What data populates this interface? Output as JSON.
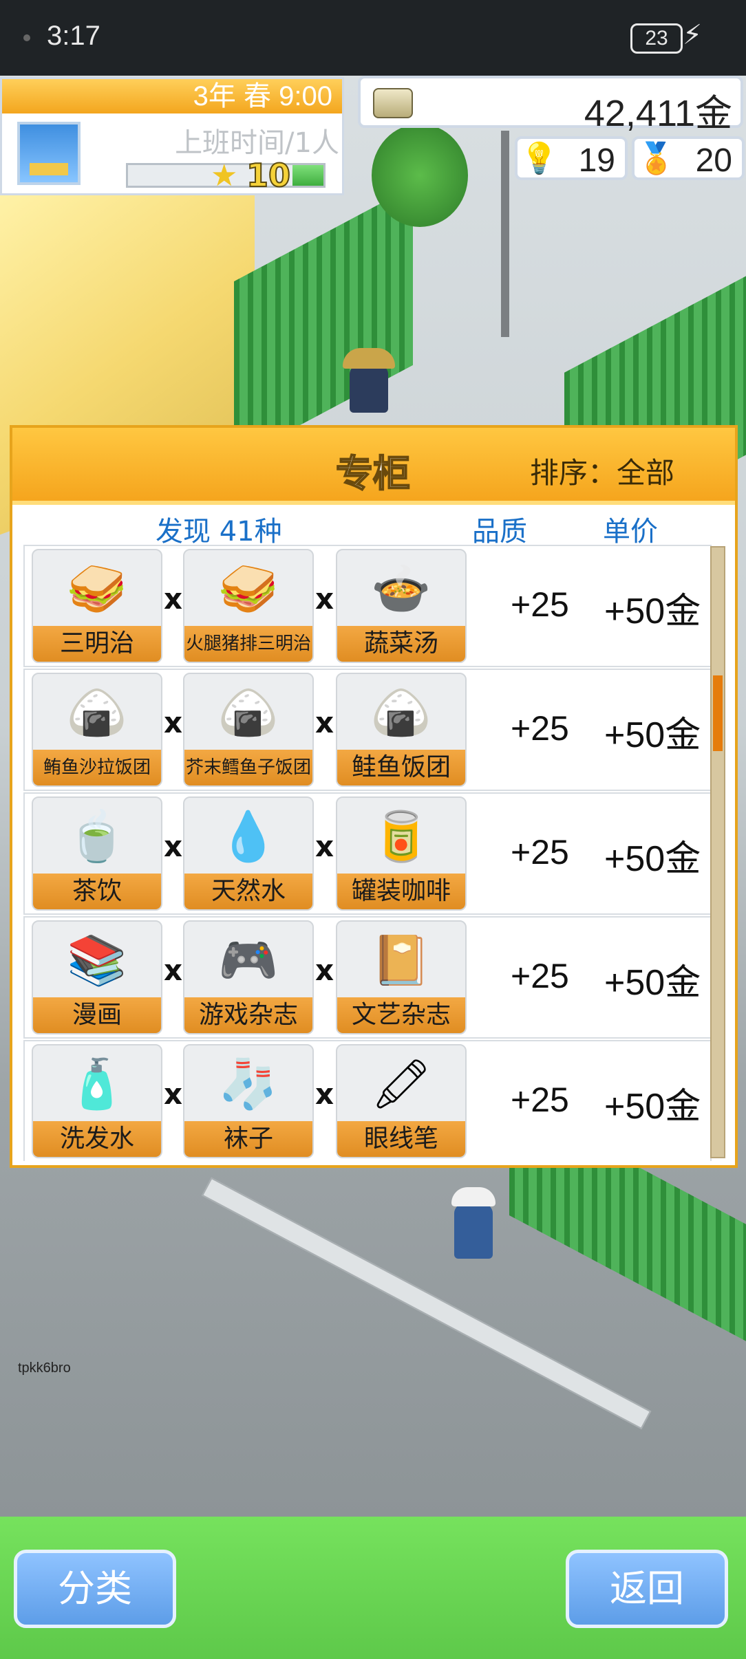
{
  "status_bar": {
    "time": "3:17",
    "battery": "23"
  },
  "hud": {
    "date": "3年 春 9:00",
    "staff_status": "上班时间/1人",
    "level": "10",
    "money": "42,411金",
    "research_points": "19",
    "medals": "20"
  },
  "panel": {
    "title": "专柜",
    "sort_label": "排序：全部",
    "found_label": "发现 41种",
    "quality_header": "品质",
    "price_header": "单价",
    "rows": [
      {
        "items": [
          "三明治",
          "火腿猪排三明治",
          "蔬菜汤"
        ],
        "quality": "+25",
        "price": "+50金"
      },
      {
        "items": [
          "鲔鱼沙拉饭团",
          "芥末鳕鱼子饭团",
          "鲑鱼饭团"
        ],
        "quality": "+25",
        "price": "+50金"
      },
      {
        "items": [
          "茶饮",
          "天然水",
          "罐装咖啡"
        ],
        "quality": "+25",
        "price": "+50金"
      },
      {
        "items": [
          "漫画",
          "游戏杂志",
          "文艺杂志"
        ],
        "quality": "+25",
        "price": "+50金"
      },
      {
        "items": [
          "洗发水",
          "袜子",
          "眼线笔"
        ],
        "quality": "+25",
        "price": "+50金"
      }
    ],
    "scroll_position": 0.24
  },
  "bottom": {
    "left_button": "分类",
    "right_button": "返回"
  },
  "watermark": "tpkk6bro"
}
